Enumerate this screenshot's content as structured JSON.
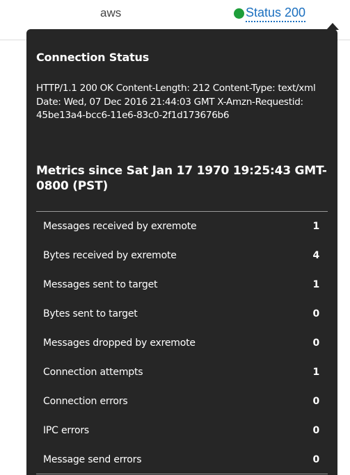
{
  "header": {
    "host_label": "aws",
    "status_label": "Status 200",
    "status_color": "#1e9e3a",
    "link_color": "#1a6fbf"
  },
  "popover": {
    "title": "Connection Status",
    "response_text": "HTTP/1.1 200 OK Content-Length: 212 Content-Type: text/xml Date: Wed, 07 Dec 2016 21:44:03 GMT X-Amzn-Requestid: 45be13a4-bcc6-11e6-83c0-2f1d173676b6",
    "metrics_title": "Metrics since Sat Jan 17 1970 19:25:43 GMT-0800 (PST)",
    "background_color": "#262626",
    "metrics": [
      {
        "label": "Messages received by exremote",
        "value": "1"
      },
      {
        "label": "Bytes received by exremote",
        "value": "4"
      },
      {
        "label": "Messages sent to target",
        "value": "1"
      },
      {
        "label": "Bytes sent to target",
        "value": "0"
      },
      {
        "label": "Messages dropped by exremote",
        "value": "0"
      },
      {
        "label": "Connection attempts",
        "value": "1"
      },
      {
        "label": "Connection errors",
        "value": "0"
      },
      {
        "label": "IPC errors",
        "value": "0"
      },
      {
        "label": "Message send errors",
        "value": "0"
      }
    ]
  }
}
